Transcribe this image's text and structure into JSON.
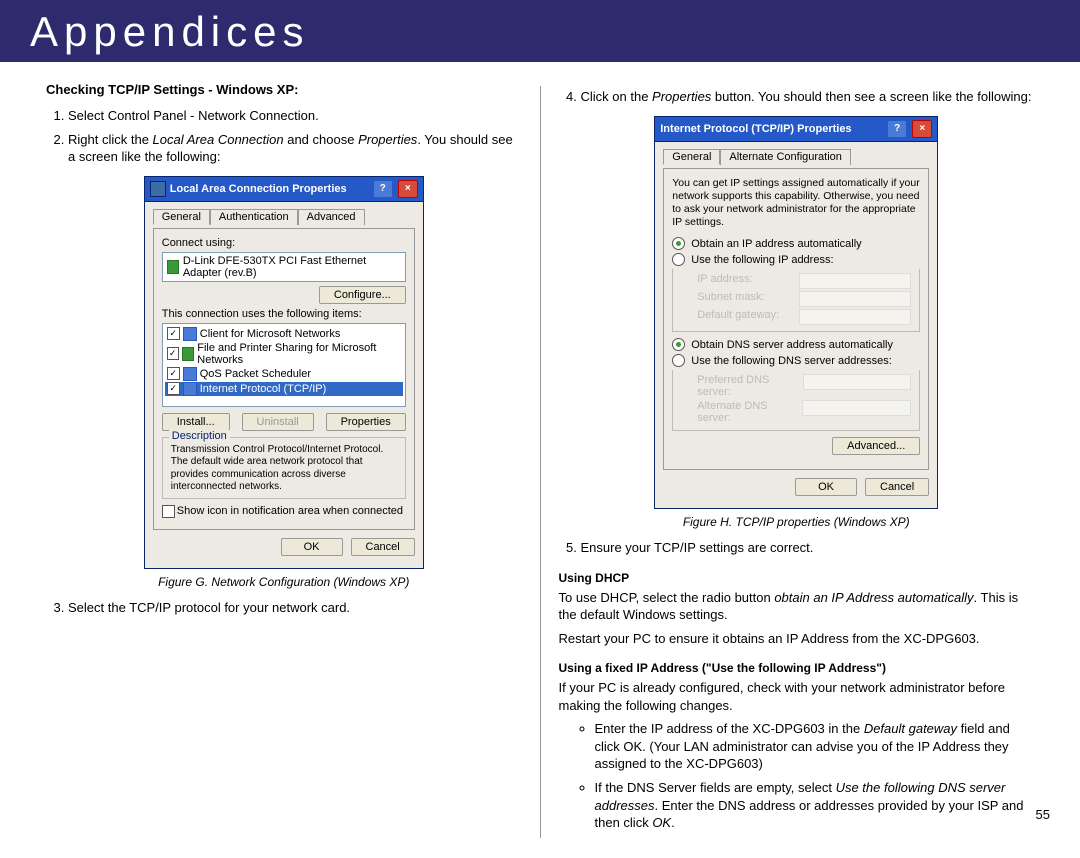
{
  "header": {
    "title": "Appendices"
  },
  "page_number": "55",
  "left": {
    "heading": "Checking TCP/IP Settings - Windows XP:",
    "step1": "Select Control Panel - Network Connection.",
    "step2_a": "Right click the ",
    "step2_i": "Local Area Connection",
    "step2_b": " and choose ",
    "step2_i2": "Properties",
    "step2_c": ". You should see a screen like the following:",
    "figG": {
      "title": "Local Area Connection Properties",
      "tab1": "General",
      "tab2": "Authentication",
      "tab3": "Advanced",
      "connect_using": "Connect using:",
      "adapter": "D-Link DFE-530TX PCI Fast Ethernet Adapter (rev.B)",
      "configure": "Configure...",
      "items_label": "This connection uses the following items:",
      "item1": "Client for Microsoft Networks",
      "item2": "File and Printer Sharing for Microsoft Networks",
      "item3": "QoS Packet Scheduler",
      "item4": "Internet Protocol (TCP/IP)",
      "install": "Install...",
      "uninstall": "Uninstall",
      "properties": "Properties",
      "desc_label": "Description",
      "desc": "Transmission Control Protocol/Internet Protocol. The default wide area network protocol that provides communication across diverse interconnected networks.",
      "showicon": "Show icon in notification area when connected",
      "ok": "OK",
      "cancel": "Cancel",
      "caption": "Figure G. Network Configuration (Windows XP)"
    },
    "step3": "Select the TCP/IP protocol for your network card."
  },
  "right": {
    "step4_a": "Click on the ",
    "step4_i": "Properties",
    "step4_b": " button. You should then see a screen like the following:",
    "figH": {
      "title": "Internet Protocol (TCP/IP) Properties",
      "tab1": "General",
      "tab2": "Alternate Configuration",
      "intro": "You can get IP settings assigned automatically if your network supports this capability. Otherwise, you need to ask your network administrator for the appropriate IP settings.",
      "r1": "Obtain an IP address automatically",
      "r2": "Use the following IP address:",
      "f1": "IP address:",
      "f2": "Subnet mask:",
      "f3": "Default gateway:",
      "r3": "Obtain DNS server address automatically",
      "r4": "Use the following DNS server addresses:",
      "f4": "Preferred DNS server:",
      "f5": "Alternate DNS server:",
      "advanced": "Advanced...",
      "ok": "OK",
      "cancel": "Cancel",
      "caption": "Figure H. TCP/IP properties (Windows XP)"
    },
    "step5": "Ensure your TCP/IP settings are correct.",
    "dhcp_head": "Using DHCP",
    "dhcp_p1_a": "To use DHCP, select the radio button ",
    "dhcp_p1_i": "obtain an IP Address automatically",
    "dhcp_p1_b": ". This is the default Windows settings.",
    "dhcp_p2": "Restart your PC to ensure it obtains an IP Address from the XC-DPG603.",
    "fixed_head": "Using a fixed IP Address (\"Use the following IP Address\")",
    "fixed_p1": "If your PC is already configured, check with your network administrator before making the following changes.",
    "b1_a": "Enter the IP address of the XC-DPG603 in the ",
    "b1_i": "Default gateway",
    "b1_b": " field and click OK. (Your LAN administrator can advise you of the IP Address they assigned to the XC-DPG603)",
    "b2_a": "If the DNS Server fields are empty, select ",
    "b2_i": "Use the following DNS server addresses",
    "b2_b": ". Enter the DNS address or addresses provided by your ISP and then click ",
    "b2_i2": "OK",
    "b2_c": "."
  }
}
